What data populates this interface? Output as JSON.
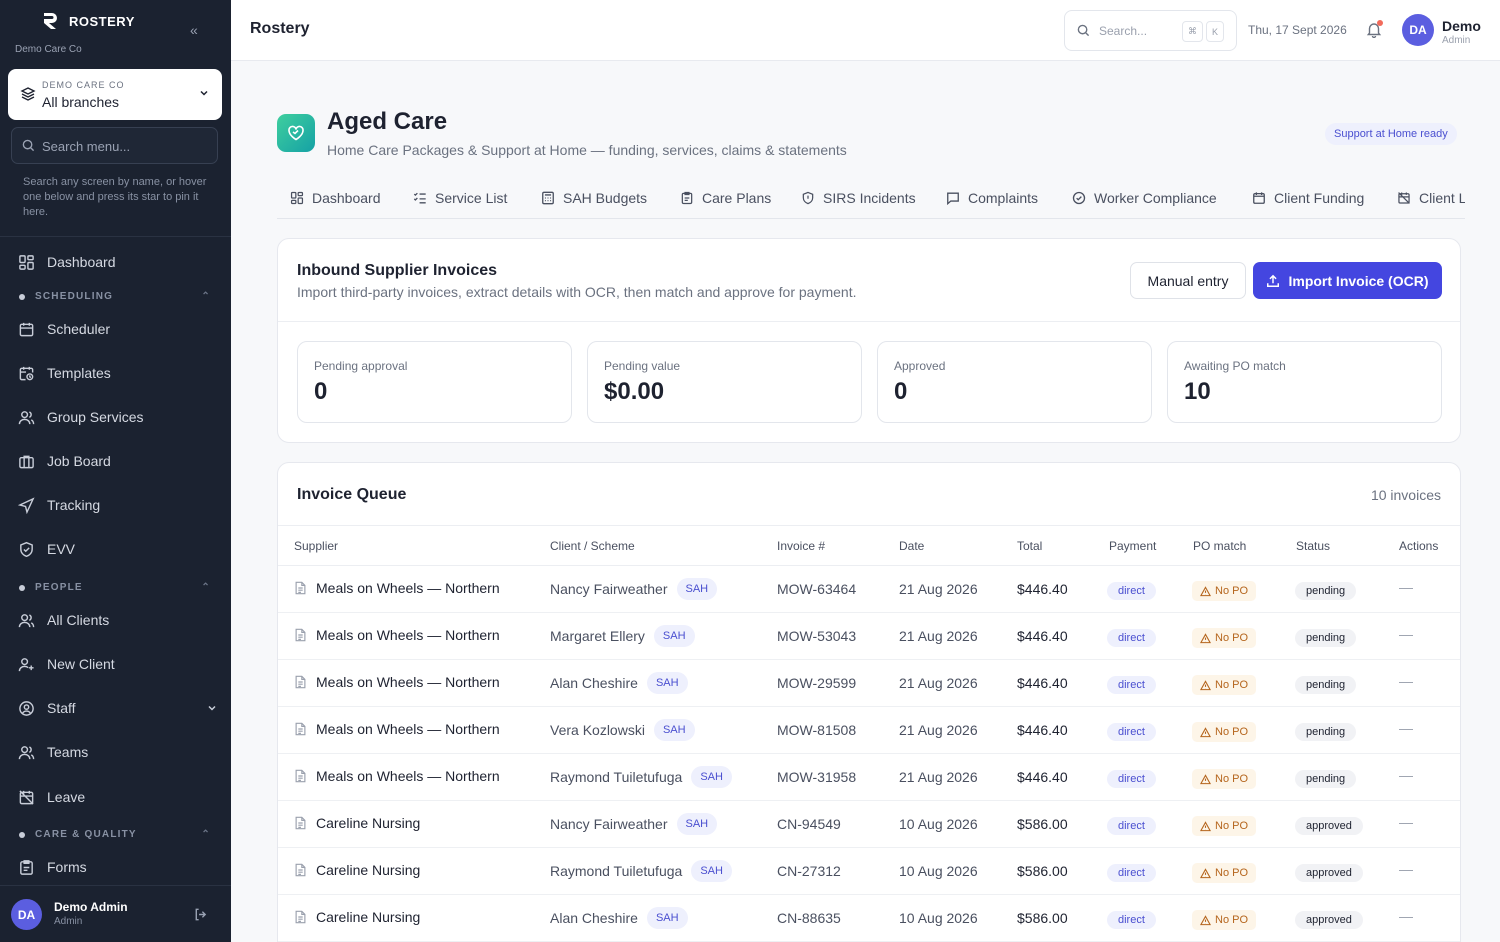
{
  "app": {
    "name": "ROSTERY",
    "org": "Demo Care Co"
  },
  "branch": {
    "org_label": "DEMO CARE CO",
    "name": "All branches"
  },
  "sidebar": {
    "search_placeholder": "Search menu...",
    "hint": "Search any screen by name, or hover one below and press its star to pin it here.",
    "items": [
      {
        "label": "Dashboard",
        "icon": "dashboard-icon"
      },
      {
        "label": "Scheduler",
        "icon": "calendar-icon"
      },
      {
        "label": "Templates",
        "icon": "calendar-clock-icon"
      },
      {
        "label": "Group Services",
        "icon": "users-icon"
      },
      {
        "label": "Job Board",
        "icon": "briefcase-icon"
      },
      {
        "label": "Tracking",
        "icon": "navigation-icon"
      },
      {
        "label": "EVV",
        "icon": "shield-check-icon"
      },
      {
        "label": "All Clients",
        "icon": "users-icon"
      },
      {
        "label": "New Client",
        "icon": "user-plus-icon"
      },
      {
        "label": "Staff",
        "icon": "user-circle-icon"
      },
      {
        "label": "Teams",
        "icon": "users-icon"
      },
      {
        "label": "Leave",
        "icon": "calendar-off-icon"
      },
      {
        "label": "Forms",
        "icon": "clipboard-icon"
      }
    ],
    "sections": [
      "SCHEDULING",
      "PEOPLE",
      "CARE & QUALITY"
    ],
    "user": {
      "initials": "DA",
      "name": "Demo Admin",
      "role": "Admin"
    }
  },
  "topbar": {
    "title": "Rostery",
    "search_placeholder": "Search...",
    "kbd1": "⌘",
    "kbd2": "K",
    "date": "Thu, 17 Sept 2026",
    "user": {
      "initials": "DA",
      "name": "Demo",
      "role": "Admin"
    }
  },
  "page": {
    "title": "Aged Care",
    "subtitle": "Home Care Packages & Support at Home — funding, services, claims & statements",
    "badge": "Support at Home ready",
    "tabs": [
      "Dashboard",
      "Service List",
      "SAH Budgets",
      "Care Plans",
      "SIRS Incidents",
      "Complaints",
      "Worker Compliance",
      "Client Funding",
      "Client L"
    ]
  },
  "invoices_card": {
    "title": "Inbound Supplier Invoices",
    "subtitle": "Import third-party invoices, extract details with OCR, then match and approve for payment.",
    "manual_label": "Manual entry",
    "import_label": "Import Invoice (OCR)",
    "stats": [
      {
        "label": "Pending approval",
        "value": "0"
      },
      {
        "label": "Pending value",
        "value": "$0.00"
      },
      {
        "label": "Approved",
        "value": "0"
      },
      {
        "label": "Awaiting PO match",
        "value": "10"
      }
    ]
  },
  "queue": {
    "title": "Invoice Queue",
    "count": "10 invoices",
    "columns": [
      "Supplier",
      "Client / Scheme",
      "Invoice #",
      "Date",
      "Total",
      "Payment",
      "PO match",
      "Status",
      "Actions"
    ],
    "rows": [
      {
        "supplier": "Meals on Wheels — Northern",
        "client": "Nancy Fairweather",
        "scheme": "SAH",
        "invoice": "MOW-63464",
        "date": "21 Aug 2026",
        "total": "$446.40",
        "payment": "direct",
        "po": "No PO",
        "status": "pending",
        "action": "—"
      },
      {
        "supplier": "Meals on Wheels — Northern",
        "client": "Margaret Ellery",
        "scheme": "SAH",
        "invoice": "MOW-53043",
        "date": "21 Aug 2026",
        "total": "$446.40",
        "payment": "direct",
        "po": "No PO",
        "status": "pending",
        "action": "—"
      },
      {
        "supplier": "Meals on Wheels — Northern",
        "client": "Alan Cheshire",
        "scheme": "SAH",
        "invoice": "MOW-29599",
        "date": "21 Aug 2026",
        "total": "$446.40",
        "payment": "direct",
        "po": "No PO",
        "status": "pending",
        "action": "—"
      },
      {
        "supplier": "Meals on Wheels — Northern",
        "client": "Vera Kozlowski",
        "scheme": "SAH",
        "invoice": "MOW-81508",
        "date": "21 Aug 2026",
        "total": "$446.40",
        "payment": "direct",
        "po": "No PO",
        "status": "pending",
        "action": "—"
      },
      {
        "supplier": "Meals on Wheels — Northern",
        "client": "Raymond Tuiletufuga",
        "scheme": "SAH",
        "invoice": "MOW-31958",
        "date": "21 Aug 2026",
        "total": "$446.40",
        "payment": "direct",
        "po": "No PO",
        "status": "pending",
        "action": "—"
      },
      {
        "supplier": "Careline Nursing",
        "client": "Nancy Fairweather",
        "scheme": "SAH",
        "invoice": "CN-94549",
        "date": "10 Aug 2026",
        "total": "$586.00",
        "payment": "direct",
        "po": "No PO",
        "status": "approved",
        "action": "—"
      },
      {
        "supplier": "Careline Nursing",
        "client": "Raymond Tuiletufuga",
        "scheme": "SAH",
        "invoice": "CN-27312",
        "date": "10 Aug 2026",
        "total": "$586.00",
        "payment": "direct",
        "po": "No PO",
        "status": "approved",
        "action": "—"
      },
      {
        "supplier": "Careline Nursing",
        "client": "Alan Cheshire",
        "scheme": "SAH",
        "invoice": "CN-88635",
        "date": "10 Aug 2026",
        "total": "$586.00",
        "payment": "direct",
        "po": "No PO",
        "status": "approved",
        "action": "—"
      }
    ]
  },
  "colors": {
    "sidebar_bg": "#1b2230",
    "accent": "#4446e0",
    "teal": "#15a1a5",
    "warning": "#b5651d"
  }
}
